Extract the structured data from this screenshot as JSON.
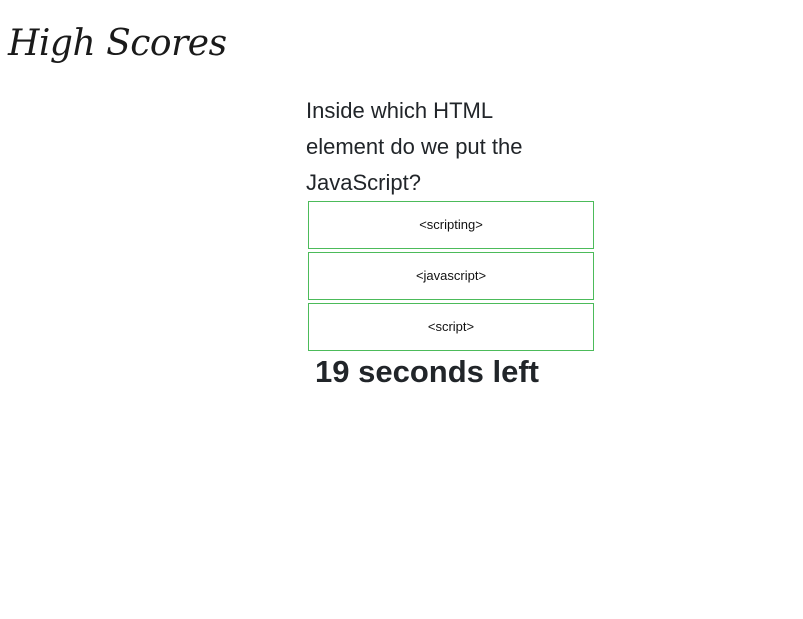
{
  "header": {
    "high_scores_link": "High Scores"
  },
  "quiz": {
    "question": "Inside which HTML element do we put the JavaScript?",
    "choices": [
      "<scripting>",
      "<javascript>",
      "<script>"
    ],
    "timer_text": "19 seconds left"
  },
  "colors": {
    "choice_border": "#4cbb5a",
    "text": "#212529"
  }
}
